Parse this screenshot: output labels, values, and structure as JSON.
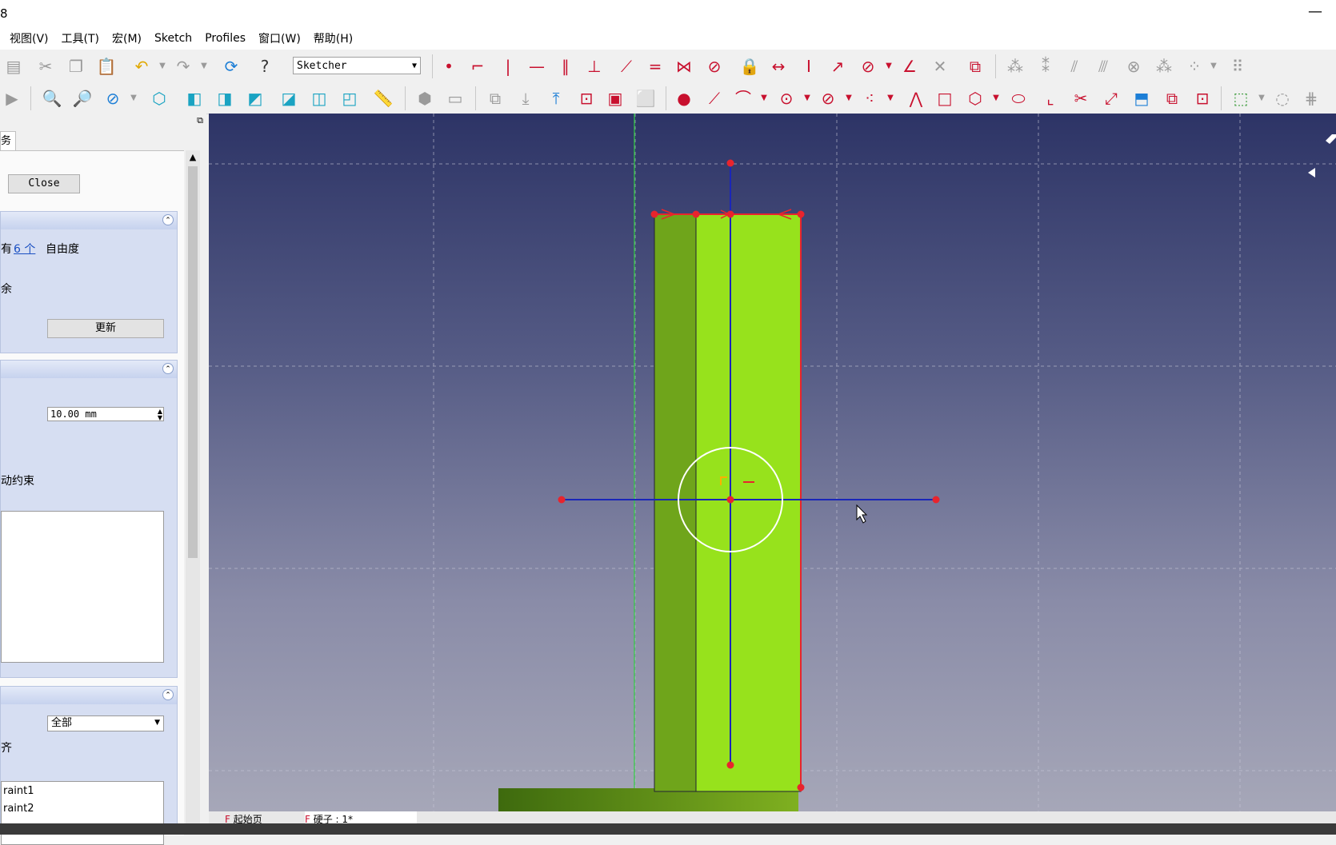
{
  "window": {
    "title_fragment": "8",
    "minimize_label": "—"
  },
  "menu": [
    "视图(V)",
    "工具(T)",
    "宏(M)",
    "Sketch",
    "Profiles",
    "窗口(W)",
    "帮助(H)"
  ],
  "toolbar": {
    "workbench_selected": "Sketcher"
  },
  "panel": {
    "tab_label": "务",
    "close_label": "Close",
    "solver": {
      "prefix": "有",
      "dof_link": "6 个",
      "dof_suffix": "自由度",
      "redundant_fragment": "余",
      "update_label": "更新"
    },
    "edit_controls": {
      "grid_size_value": "10.00 mm",
      "auto_constraint_fragment": "动约束"
    },
    "constraints": {
      "filter_selected": "全部",
      "align_fragment": "齐",
      "items": [
        "raint1",
        "raint2"
      ]
    }
  },
  "doc_tabs": [
    "起始页",
    "硬子 : 1*"
  ],
  "colors": {
    "sketch_red": "#e8242d",
    "axis_blue": "#1a26b8",
    "face_green": "#97e21c",
    "side_green": "#6fa51b"
  }
}
